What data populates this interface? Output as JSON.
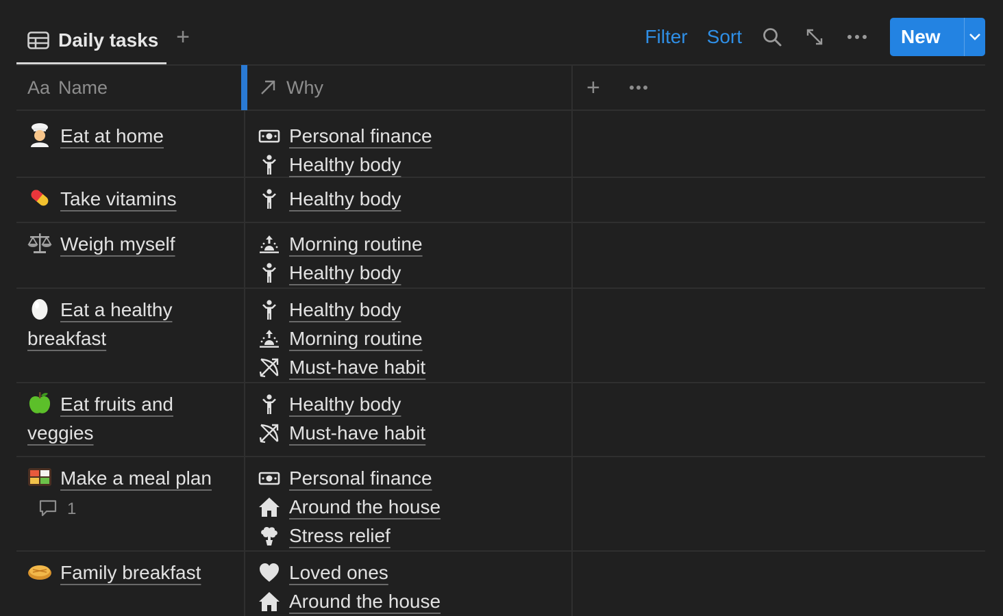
{
  "view": {
    "title": "Daily tasks",
    "icon": "table-icon",
    "add_view_symbol": "+"
  },
  "toolbar": {
    "filter": "Filter",
    "sort": "Sort",
    "new_label": "New",
    "accent": "#2383e2"
  },
  "columns": {
    "name": {
      "prefix": "Aa",
      "label": "Name"
    },
    "why": {
      "icon": "arrow-up-right-icon",
      "label": "Why"
    },
    "add_symbol": "+"
  },
  "rows": [
    {
      "emoji": "chef-emoji",
      "name_line1": "Eat at home",
      "name_line2": "",
      "why": [
        {
          "icon": "money-icon",
          "label": "Personal finance"
        },
        {
          "icon": "person-icon",
          "label": "Healthy body"
        }
      ]
    },
    {
      "emoji": "pill-emoji",
      "name_line1": "Take vitamins",
      "name_line2": "",
      "why": [
        {
          "icon": "person-icon",
          "label": "Healthy body"
        }
      ]
    },
    {
      "emoji": "scales-emoji",
      "name_line1": "Weigh myself",
      "name_line2": "",
      "why": [
        {
          "icon": "sunrise-icon",
          "label": "Morning routine"
        },
        {
          "icon": "person-icon",
          "label": "Healthy body"
        }
      ]
    },
    {
      "emoji": "egg-emoji",
      "name_line1": "Eat a healthy",
      "name_line2": "breakfast",
      "why": [
        {
          "icon": "person-icon",
          "label": "Healthy body"
        },
        {
          "icon": "sunrise-icon",
          "label": "Morning routine"
        },
        {
          "icon": "bow-arrow-icon",
          "label": "Must-have habit"
        }
      ]
    },
    {
      "emoji": "green-apple-emoji",
      "name_line1": "Eat fruits and",
      "name_line2": "veggies",
      "why": [
        {
          "icon": "person-icon",
          "label": "Healthy body"
        },
        {
          "icon": "bow-arrow-icon",
          "label": "Must-have habit"
        }
      ]
    },
    {
      "emoji": "bento-emoji",
      "name_line1": "Make a meal plan",
      "name_line2": "",
      "comment_count": "1",
      "why": [
        {
          "icon": "money-icon",
          "label": "Personal finance"
        },
        {
          "icon": "house-icon",
          "label": "Around the house"
        },
        {
          "icon": "brain-icon",
          "label": "Stress relief"
        }
      ]
    },
    {
      "emoji": "pie-emoji",
      "name_line1": "Family breakfast",
      "name_line2": "",
      "why": [
        {
          "icon": "heart-icon",
          "label": "Loved ones"
        },
        {
          "icon": "house-icon",
          "label": "Around the house"
        }
      ]
    }
  ]
}
